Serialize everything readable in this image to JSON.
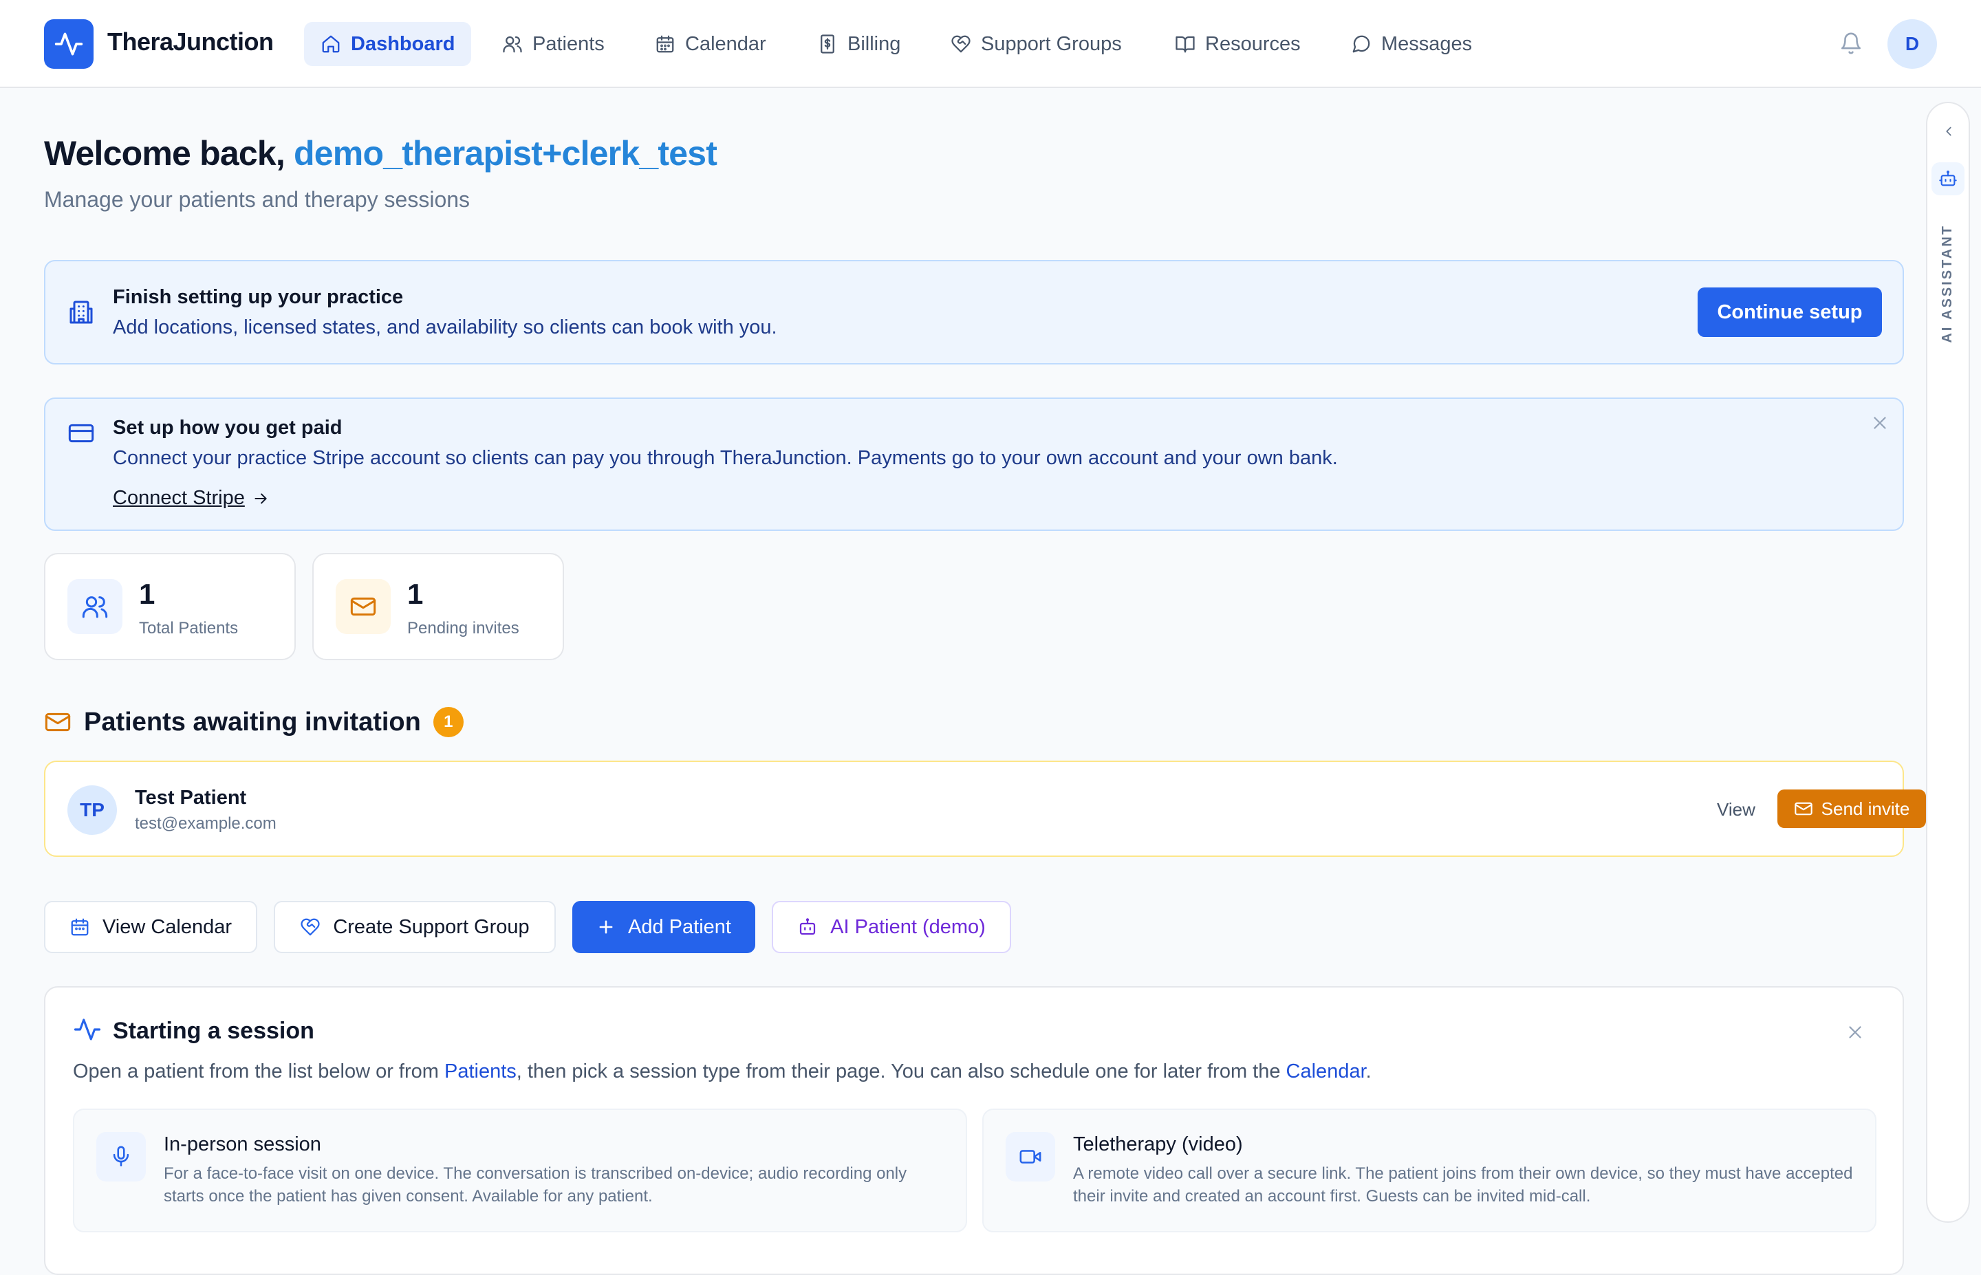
{
  "app": {
    "brand": "TheraJunction",
    "avatar_initial": "D"
  },
  "nav": [
    {
      "label": "Dashboard",
      "icon": "home-icon",
      "active": true
    },
    {
      "label": "Patients",
      "icon": "users-icon"
    },
    {
      "label": "Calendar",
      "icon": "calendar-icon"
    },
    {
      "label": "Billing",
      "icon": "receipt-icon"
    },
    {
      "label": "Support Groups",
      "icon": "heart-handshake-icon"
    },
    {
      "label": "Resources",
      "icon": "book-open-icon"
    },
    {
      "label": "Messages",
      "icon": "message-circle-icon"
    }
  ],
  "ai_assistant": {
    "label": "AI ASSISTANT"
  },
  "welcome": {
    "prefix": "Welcome back,",
    "username": "demo_therapist+clerk_test",
    "subtitle": "Manage your patients and therapy sessions"
  },
  "setup_banner": {
    "title": "Finish setting up your practice",
    "text": "Add locations, licensed states, and availability so clients can book with you.",
    "button": "Continue setup"
  },
  "payment_banner": {
    "title": "Set up how you get paid",
    "text": "Connect your practice Stripe account so clients can pay you through TheraJunction. Payments go to your own account and your own bank.",
    "link": "Connect Stripe"
  },
  "stats": [
    {
      "value": "1",
      "label": "Total Patients",
      "icon": "users-icon"
    },
    {
      "value": "1",
      "label": "Pending invites",
      "icon": "mail-icon"
    }
  ],
  "awaiting": {
    "title": "Patients awaiting invitation",
    "count": "1",
    "patients": [
      {
        "initials": "TP",
        "name": "Test Patient",
        "email": "test@example.com",
        "view_label": "View",
        "invite_label": "Send invite"
      }
    ]
  },
  "actions": {
    "view_calendar": "View Calendar",
    "create_group": "Create Support Group",
    "add_patient": "Add Patient",
    "ai_patient": "AI Patient (demo)"
  },
  "session_guide": {
    "title": "Starting a session",
    "text_1": "Open a patient from the list below or from ",
    "link_patients": "Patients",
    "text_2": ", then pick a session type from their page. You can also schedule one for later from the ",
    "link_calendar": "Calendar",
    "text_3": ".",
    "modes": [
      {
        "title": "In-person session",
        "icon": "mic-icon",
        "description": "For a face-to-face visit on one device. The conversation is transcribed on-device; audio recording only starts once the patient has given consent. Available for any patient."
      },
      {
        "title": "Teletherapy (video)",
        "icon": "video-icon",
        "description": "A remote video call over a secure link. The patient joins from their own device, so they must have accepted their invite and created an account first. Guests can be invited mid-call."
      }
    ]
  },
  "colors": {
    "primary": "#2563eb",
    "username": "#2585d9",
    "warning": "#d97706",
    "badge": "#f59e0b",
    "ai_purple": "#6d28d9"
  }
}
